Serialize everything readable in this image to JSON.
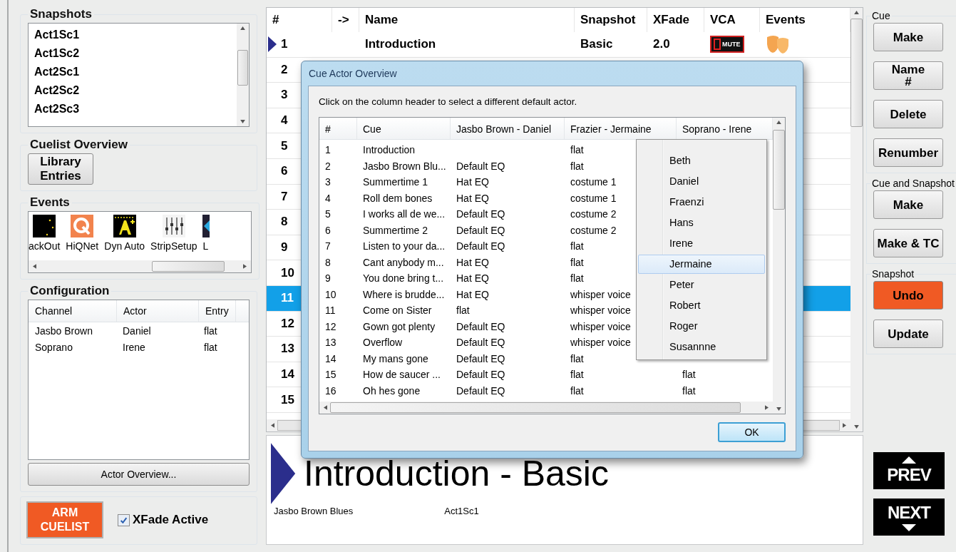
{
  "snapshots": {
    "title": "Snapshots",
    "items": [
      {
        "label": "Act1Sc1"
      },
      {
        "label": "Act1Sc2"
      },
      {
        "label": "Act2Sc1"
      },
      {
        "label": "Act2Sc2"
      },
      {
        "label": "Act2Sc3"
      }
    ]
  },
  "cuelist_overview": {
    "title": "Cuelist Overview",
    "button": [
      "Library",
      "Entries"
    ]
  },
  "events": {
    "title": "Events",
    "items": [
      {
        "kind": "blackout",
        "label": "ackOut"
      },
      {
        "kind": "hiqnet",
        "label": "HiQNet"
      },
      {
        "kind": "dynauto",
        "label": "Dyn Auto"
      },
      {
        "kind": "stripsetup",
        "label": "StripSetup"
      },
      {
        "kind": "partial",
        "label": "L"
      }
    ]
  },
  "configuration": {
    "title": "Configuration",
    "columns": [
      "Channel",
      "Actor",
      "Entry"
    ],
    "rows": [
      [
        "Jasbo Brown",
        "Daniel",
        "flat"
      ],
      [
        "Soprano",
        "Irene",
        "flat"
      ]
    ],
    "button": "Actor Overview..."
  },
  "arm_button": [
    "ARM",
    "CUELIST"
  ],
  "xfade_active": {
    "label": "XFade Active",
    "checked": true
  },
  "cuelist": {
    "columns": [
      "#",
      "->",
      "Name",
      "Snapshot",
      "XFade",
      "VCA",
      "Events"
    ],
    "rows": [
      {
        "number": "1",
        "name": "Introduction",
        "snapshot": "Basic",
        "xfade": "2.0",
        "vca_label": "MUTE",
        "current": true,
        "selected": false
      },
      {
        "number": "2",
        "current": false,
        "selected": false
      },
      {
        "number": "3",
        "current": false,
        "selected": false
      },
      {
        "number": "4",
        "current": false,
        "selected": false
      },
      {
        "number": "5",
        "current": false,
        "selected": false
      },
      {
        "number": "6",
        "current": false,
        "selected": false
      },
      {
        "number": "7",
        "current": false,
        "selected": false
      },
      {
        "number": "8",
        "current": false,
        "selected": false
      },
      {
        "number": "9",
        "current": false,
        "selected": false
      },
      {
        "number": "10",
        "current": false,
        "selected": false
      },
      {
        "number": "11",
        "current": false,
        "selected": true
      },
      {
        "number": "12",
        "current": false,
        "selected": false
      },
      {
        "number": "13",
        "current": false,
        "selected": false
      },
      {
        "number": "14",
        "current": false,
        "selected": false
      },
      {
        "number": "15",
        "current": false,
        "selected": false
      }
    ]
  },
  "current_cue": {
    "title": "Introduction - Basic",
    "name": "Jasbo Brown Blues",
    "snapshot": "Act1Sc1"
  },
  "dialog": {
    "title": "Cue Actor Overview",
    "instruction": "Click on the column header to select a different default actor.",
    "columns": [
      "#",
      "Cue",
      "Jasbo Brown - Daniel",
      "Frazier - Jermaine",
      "Soprano - Irene"
    ],
    "rows": [
      {
        "number": "1",
        "cue": "Introduction",
        "frazier": "flat"
      },
      {
        "number": "2",
        "cue": "Jasbo Brown Blu...",
        "jasbo": "Default EQ",
        "frazier": "flat"
      },
      {
        "number": "3",
        "cue": "Summertime 1",
        "jasbo": "Hat EQ",
        "frazier": "costume 1"
      },
      {
        "number": "4",
        "cue": "Roll dem bones",
        "jasbo": "Hat EQ",
        "frazier": "costume 1"
      },
      {
        "number": "5",
        "cue": "I works all de we...",
        "jasbo": "Default EQ",
        "frazier": "costume 2"
      },
      {
        "number": "6",
        "cue": "Summertime 2",
        "jasbo": "Default EQ",
        "frazier": "costume 2"
      },
      {
        "number": "7",
        "cue": "Listen to your da...",
        "jasbo": "Default EQ",
        "frazier": "flat"
      },
      {
        "number": "8",
        "cue": "Cant anybody m...",
        "jasbo": "Hat EQ",
        "frazier": "flat"
      },
      {
        "number": "9",
        "cue": "You done bring t...",
        "jasbo": "Hat EQ",
        "frazier": "flat"
      },
      {
        "number": "10",
        "cue": "Where is brudde...",
        "jasbo": "Hat EQ",
        "frazier": "whisper voice"
      },
      {
        "number": "11",
        "cue": "Come on Sister",
        "jasbo": "flat",
        "frazier": "whisper voice"
      },
      {
        "number": "12",
        "cue": "Gown got plenty",
        "jasbo": "Default EQ",
        "frazier": "whisper voice"
      },
      {
        "number": "13",
        "cue": "Overflow",
        "jasbo": "Default EQ",
        "frazier": "whisper voice"
      },
      {
        "number": "14",
        "cue": "My mans gone",
        "jasbo": "Default EQ",
        "frazier": "flat"
      },
      {
        "number": "15",
        "cue": "How de saucer ...",
        "jasbo": "Default EQ",
        "frazier": "flat",
        "soprano": "flat"
      },
      {
        "number": "16",
        "cue": "Oh hes gone",
        "jasbo": "Default EQ",
        "frazier": "flat",
        "soprano": "flat"
      }
    ],
    "dropdown": [
      {
        "label": "Beth",
        "selected": false
      },
      {
        "label": "Daniel",
        "selected": false
      },
      {
        "label": "Fraenzi",
        "selected": false
      },
      {
        "label": "Hans",
        "selected": false
      },
      {
        "label": "Irene",
        "selected": false
      },
      {
        "label": "Jermaine",
        "selected": true
      },
      {
        "label": "Peter",
        "selected": false
      },
      {
        "label": "Robert",
        "selected": false
      },
      {
        "label": "Roger",
        "selected": false
      },
      {
        "label": "Susannne",
        "selected": false
      }
    ],
    "ok": "OK"
  },
  "right_groups": [
    {
      "title": "Cue",
      "buttons": [
        {
          "lines": [
            "Make"
          ],
          "kind": "normal"
        },
        {
          "lines": [
            "Name",
            "#"
          ],
          "kind": "normal"
        },
        {
          "lines": [
            "Delete"
          ],
          "kind": "normal"
        },
        {
          "lines": [
            "Renumber"
          ],
          "kind": "normal"
        }
      ]
    },
    {
      "title": "Cue and Snapshot",
      "buttons": [
        {
          "lines": [
            "Make"
          ],
          "kind": "normal"
        },
        {
          "lines": [
            "Make & TC"
          ],
          "kind": "normal"
        }
      ]
    },
    {
      "title": "Snapshot",
      "buttons": [
        {
          "lines": [
            "Undo"
          ],
          "kind": "alert"
        },
        {
          "lines": [
            "Update"
          ],
          "kind": "normal"
        }
      ]
    }
  ],
  "prev": "PREV",
  "next": "NEXT"
}
